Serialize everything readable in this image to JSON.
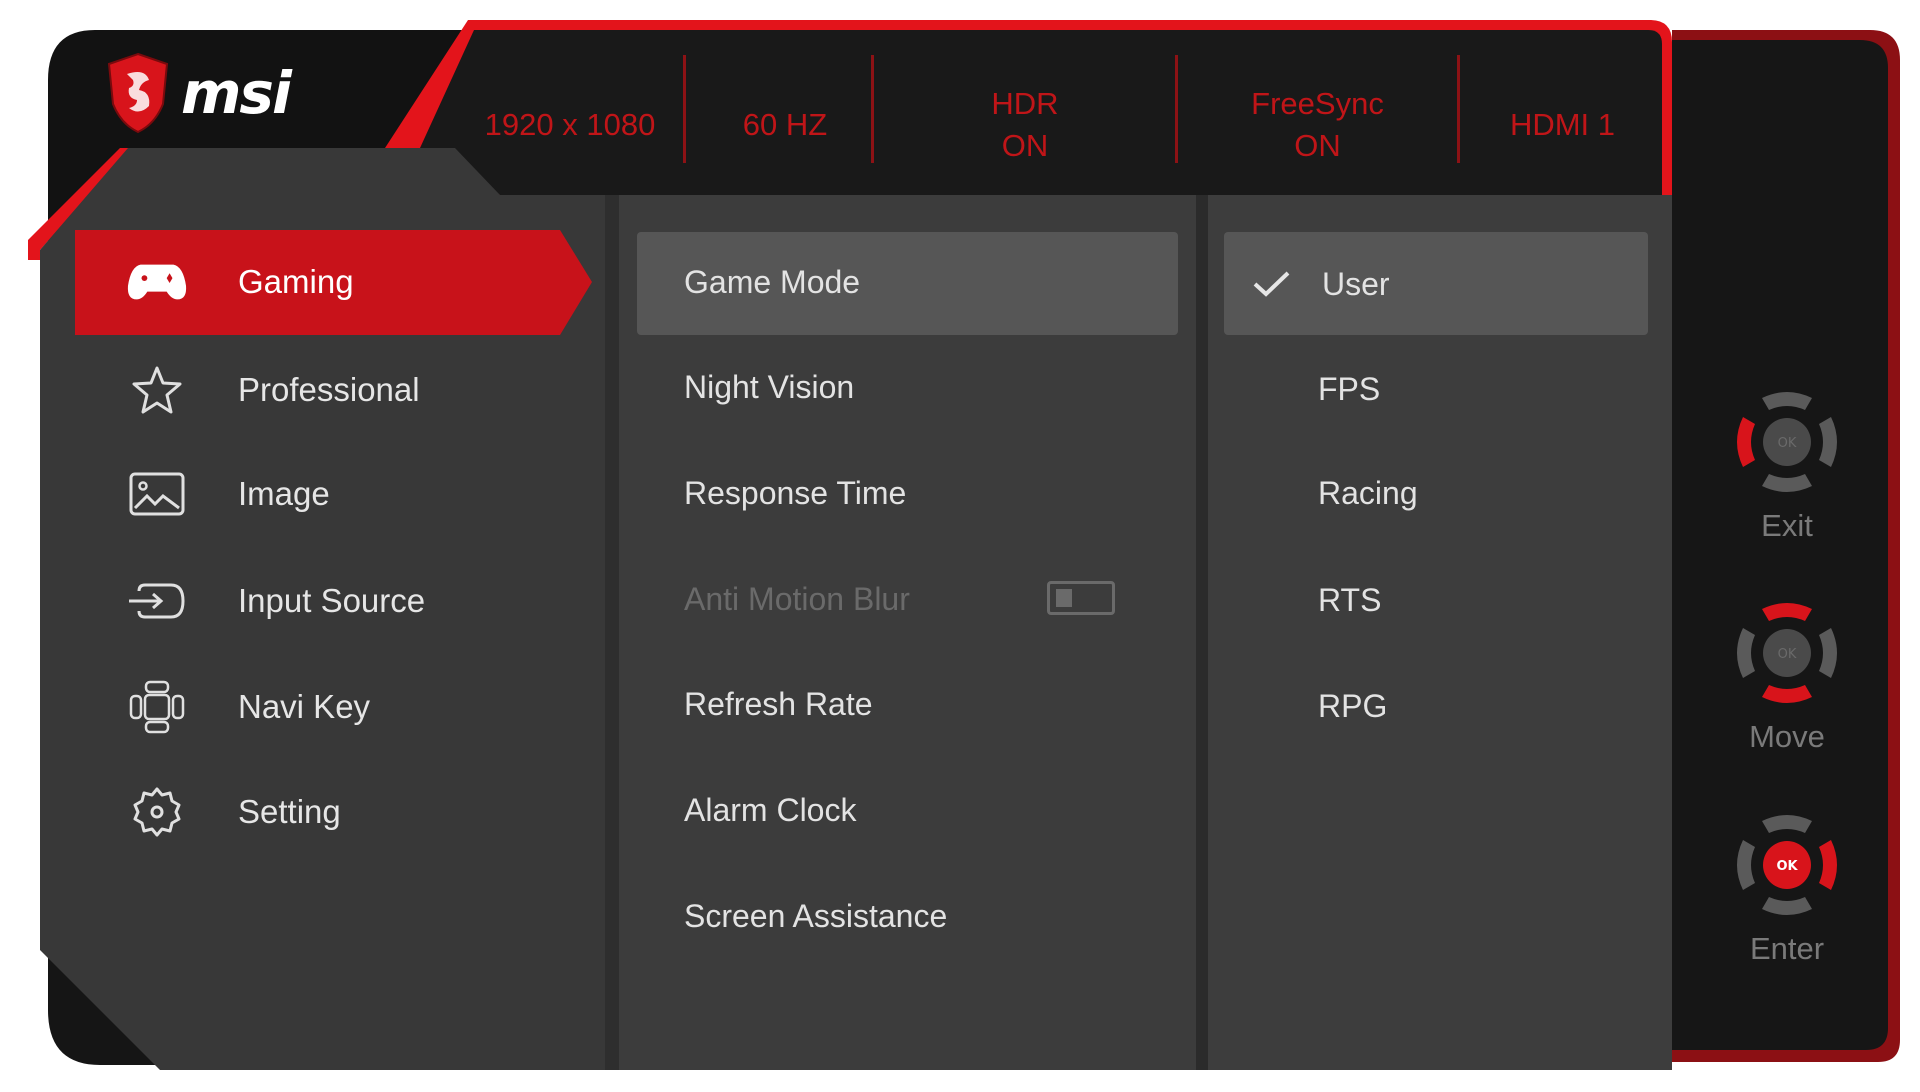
{
  "brand": {
    "name": "msi",
    "accent": "#e3141b",
    "panel": "#383838",
    "header_bg": "#161616"
  },
  "header": {
    "status": [
      {
        "id": "resolution",
        "lines": [
          "1920 x 1080"
        ]
      },
      {
        "id": "refresh",
        "lines": [
          "60 HZ"
        ]
      },
      {
        "id": "hdr",
        "lines": [
          "HDR",
          "ON"
        ]
      },
      {
        "id": "freesync",
        "lines": [
          "FreeSync",
          "ON"
        ]
      },
      {
        "id": "input",
        "lines": [
          "HDMI 1"
        ]
      }
    ]
  },
  "sidebar": {
    "items": [
      {
        "label": "Gaming",
        "icon": "gamepad-icon",
        "selected": true
      },
      {
        "label": "Professional",
        "icon": "star-icon",
        "selected": false
      },
      {
        "label": "Image",
        "icon": "image-icon",
        "selected": false
      },
      {
        "label": "Input Source",
        "icon": "input-source-icon",
        "selected": false
      },
      {
        "label": "Navi Key",
        "icon": "navi-key-icon",
        "selected": false
      },
      {
        "label": "Setting",
        "icon": "gear-icon",
        "selected": false
      }
    ]
  },
  "submenu": {
    "items": [
      {
        "label": "Game Mode",
        "selected": true,
        "disabled": false
      },
      {
        "label": "Night Vision",
        "selected": false,
        "disabled": false
      },
      {
        "label": "Response Time",
        "selected": false,
        "disabled": false
      },
      {
        "label": "Anti Motion Blur",
        "selected": false,
        "disabled": true,
        "toggle": "off"
      },
      {
        "label": "Refresh Rate",
        "selected": false,
        "disabled": false
      },
      {
        "label": "Alarm Clock",
        "selected": false,
        "disabled": false
      },
      {
        "label": "Screen Assistance",
        "selected": false,
        "disabled": false
      }
    ]
  },
  "options": {
    "items": [
      {
        "label": "User",
        "checked": true
      },
      {
        "label": "FPS",
        "checked": false
      },
      {
        "label": "Racing",
        "checked": false
      },
      {
        "label": "RTS",
        "checked": false
      },
      {
        "label": "RPG",
        "checked": false
      }
    ]
  },
  "navkeys": {
    "items": [
      {
        "label": "Exit",
        "active": "left",
        "center_text": "OK"
      },
      {
        "label": "Move",
        "active": "updown",
        "center_text": "OK"
      },
      {
        "label": "Enter",
        "active": "center-right",
        "center_text": "OK"
      }
    ]
  }
}
